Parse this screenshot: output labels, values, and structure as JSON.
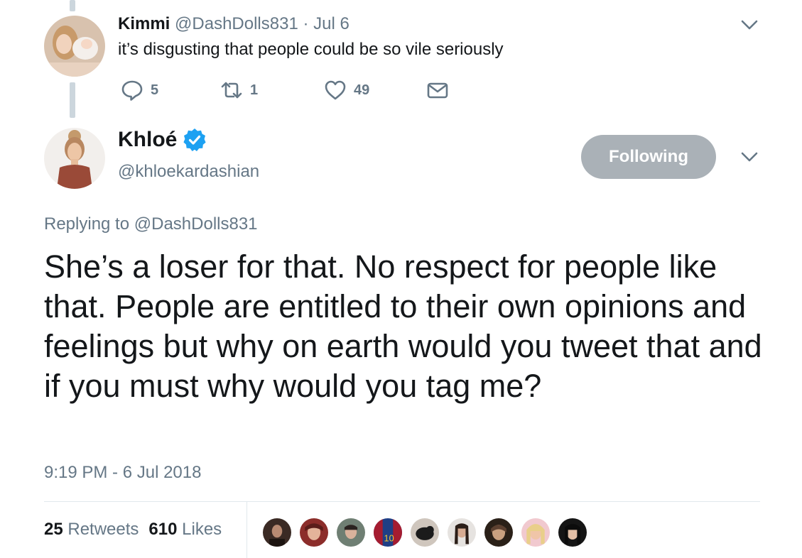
{
  "reply": {
    "name": "Kimmi",
    "handle": "@DashDolls831",
    "dot": "·",
    "time": "Jul 6",
    "text": "it’s disgusting that people could be so vile seriously",
    "replies_count": "5",
    "retweets_count": "1",
    "likes_count": "49"
  },
  "main": {
    "name": "Khloé",
    "handle": "@khloekardashian",
    "follow_label": "Following",
    "replying_prefix": "Replying to",
    "replying_mention": "@DashDolls831",
    "text": "She’s a loser for that. No respect for people like that. People are entitled to their own opinions and feelings but why on earth would you tweet that and if you must why would you tag me?",
    "timestamp": "9:19 PM - 6 Jul 2018",
    "retweets_count": "25",
    "retweets_label": "Retweets",
    "likes_count": "610",
    "likes_label": "Likes"
  },
  "colors": {
    "accent": "#1da1f2",
    "muted": "#657786",
    "following_bg": "#aab1b7",
    "divider": "#e1e8ed"
  },
  "icons": [
    "reply-icon",
    "retweet-icon",
    "heart-icon",
    "message-icon",
    "chevron-down-icon",
    "verified-badge-icon"
  ],
  "likers_count_shown": 9
}
